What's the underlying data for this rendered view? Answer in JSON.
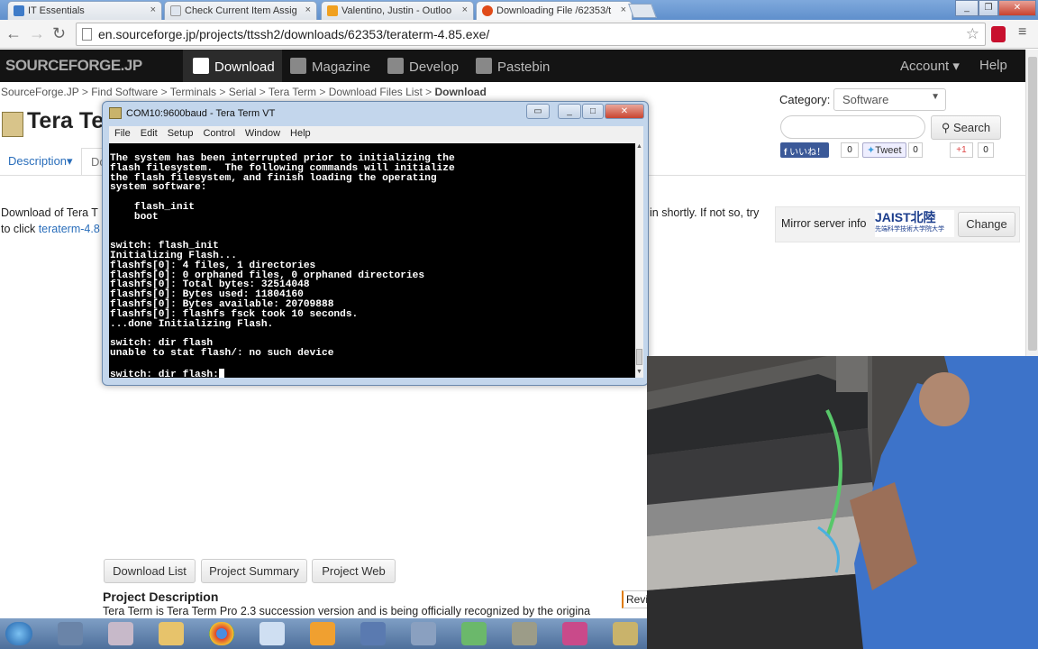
{
  "browser": {
    "tabs": [
      {
        "title": "IT Essentials",
        "fav": "#3e7bc8"
      },
      {
        "title": "Check Current Item Assig",
        "fav": "#dfe6ef"
      },
      {
        "title": "Valentino, Justin - Outloo",
        "fav": "#f0a020"
      },
      {
        "title": "Downloading File /62353/t",
        "fav": "#e04b1a"
      }
    ],
    "url": "en.sourceforge.jp/projects/ttssh2/downloads/62353/teraterm-4.85.exe/",
    "close_glyph": "×"
  },
  "sf": {
    "logo": "SOURCEFORGE.JP",
    "nav": [
      "Download",
      "Magazine",
      "Develop",
      "Pastebin"
    ],
    "account": "Account",
    "help": "Help"
  },
  "page": {
    "breadcrumb": [
      "SourceForge.JP",
      "Find Software",
      "Terminals",
      "Serial",
      "Tera Term",
      "Download Files List"
    ],
    "breadcrumb_current": "Download",
    "breadcrumb_sep": " > ",
    "title_partial": "Tera Te",
    "tabs": [
      "Description",
      "Do"
    ],
    "category_label": "Category:",
    "category_value": "Software",
    "search_button": "Search",
    "social": {
      "like": "いいね！",
      "like_count": "0",
      "tweet": "Tweet",
      "tweet_count": "0",
      "gplus": "+1",
      "gplus_count": "0"
    },
    "download_text_left": "Download of Tera T",
    "download_text_right": "in shortly. If not so, try",
    "download_text_line2": "to click ",
    "download_link": "teraterm-4.8",
    "mirror_label": "Mirror server info",
    "mirror_logo": "JAIST北陸",
    "mirror_logo_sub": "先端科学技術大学院大学",
    "change_button": "Change",
    "bottom_buttons": [
      "Download List",
      "Project Summary",
      "Project Web"
    ],
    "project_description_heading": "Project Description",
    "project_description_text": "Tera Term is Tera Term Pro 2.3 succession version and is being officially recognized by the origina",
    "review_partial": "Revi"
  },
  "teraterm": {
    "title": "COM10:9600baud - Tera Term VT",
    "menu": [
      "File",
      "Edit",
      "Setup",
      "Control",
      "Window",
      "Help"
    ],
    "lines": [
      "The system has been interrupted prior to initializing the",
      "flash filesystem.  The following commands will initialize",
      "the flash filesystem, and finish loading the operating",
      "system software:",
      "",
      "    flash_init",
      "    boot",
      "",
      "",
      "switch: flash_init",
      "Initializing Flash...",
      "flashfs[0]: 4 files, 1 directories",
      "flashfs[0]: 0 orphaned files, 0 orphaned directories",
      "flashfs[0]: Total bytes: 32514048",
      "flashfs[0]: Bytes used: 11804160",
      "flashfs[0]: Bytes available: 20709888",
      "flashfs[0]: flashfs fsck took 10 seconds.",
      "...done Initializing Flash.",
      "",
      "switch: dir flash",
      "unable to stat flash/: no such device",
      "",
      "switch: dir flash:"
    ]
  },
  "taskbar": {
    "icons": [
      "start-orb",
      "apps",
      "paint",
      "explorer",
      "chrome",
      "outlook-web",
      "outlook",
      "network",
      "people",
      "camtasia",
      "tools",
      "colors",
      "teraterm"
    ]
  }
}
